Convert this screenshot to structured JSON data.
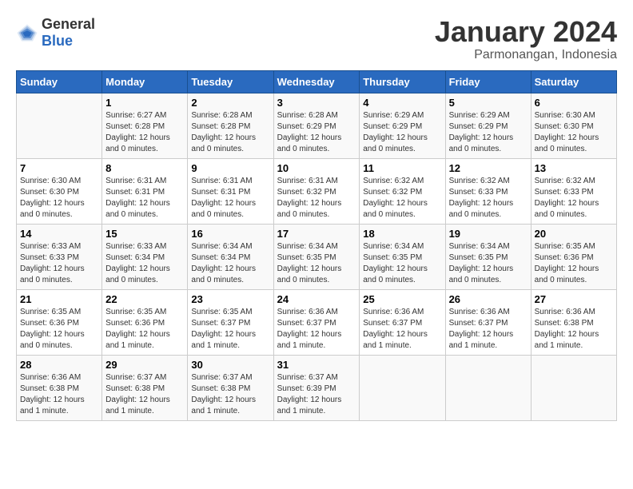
{
  "header": {
    "logo": {
      "general": "General",
      "blue": "Blue"
    },
    "title": "January 2024",
    "subtitle": "Parmonangan, Indonesia"
  },
  "days_of_week": [
    "Sunday",
    "Monday",
    "Tuesday",
    "Wednesday",
    "Thursday",
    "Friday",
    "Saturday"
  ],
  "weeks": [
    [
      {
        "day": null
      },
      {
        "day": "1",
        "sunrise": "6:27 AM",
        "sunset": "6:28 PM",
        "daylight": "12 hours and 0 minutes."
      },
      {
        "day": "2",
        "sunrise": "6:28 AM",
        "sunset": "6:28 PM",
        "daylight": "12 hours and 0 minutes."
      },
      {
        "day": "3",
        "sunrise": "6:28 AM",
        "sunset": "6:29 PM",
        "daylight": "12 hours and 0 minutes."
      },
      {
        "day": "4",
        "sunrise": "6:29 AM",
        "sunset": "6:29 PM",
        "daylight": "12 hours and 0 minutes."
      },
      {
        "day": "5",
        "sunrise": "6:29 AM",
        "sunset": "6:29 PM",
        "daylight": "12 hours and 0 minutes."
      },
      {
        "day": "6",
        "sunrise": "6:30 AM",
        "sunset": "6:30 PM",
        "daylight": "12 hours and 0 minutes."
      }
    ],
    [
      {
        "day": "7",
        "sunrise": "6:30 AM",
        "sunset": "6:30 PM",
        "daylight": "12 hours and 0 minutes."
      },
      {
        "day": "8",
        "sunrise": "6:31 AM",
        "sunset": "6:31 PM",
        "daylight": "12 hours and 0 minutes."
      },
      {
        "day": "9",
        "sunrise": "6:31 AM",
        "sunset": "6:31 PM",
        "daylight": "12 hours and 0 minutes."
      },
      {
        "day": "10",
        "sunrise": "6:31 AM",
        "sunset": "6:32 PM",
        "daylight": "12 hours and 0 minutes."
      },
      {
        "day": "11",
        "sunrise": "6:32 AM",
        "sunset": "6:32 PM",
        "daylight": "12 hours and 0 minutes."
      },
      {
        "day": "12",
        "sunrise": "6:32 AM",
        "sunset": "6:33 PM",
        "daylight": "12 hours and 0 minutes."
      },
      {
        "day": "13",
        "sunrise": "6:32 AM",
        "sunset": "6:33 PM",
        "daylight": "12 hours and 0 minutes."
      }
    ],
    [
      {
        "day": "14",
        "sunrise": "6:33 AM",
        "sunset": "6:33 PM",
        "daylight": "12 hours and 0 minutes."
      },
      {
        "day": "15",
        "sunrise": "6:33 AM",
        "sunset": "6:34 PM",
        "daylight": "12 hours and 0 minutes."
      },
      {
        "day": "16",
        "sunrise": "6:34 AM",
        "sunset": "6:34 PM",
        "daylight": "12 hours and 0 minutes."
      },
      {
        "day": "17",
        "sunrise": "6:34 AM",
        "sunset": "6:35 PM",
        "daylight": "12 hours and 0 minutes."
      },
      {
        "day": "18",
        "sunrise": "6:34 AM",
        "sunset": "6:35 PM",
        "daylight": "12 hours and 0 minutes."
      },
      {
        "day": "19",
        "sunrise": "6:34 AM",
        "sunset": "6:35 PM",
        "daylight": "12 hours and 0 minutes."
      },
      {
        "day": "20",
        "sunrise": "6:35 AM",
        "sunset": "6:36 PM",
        "daylight": "12 hours and 0 minutes."
      }
    ],
    [
      {
        "day": "21",
        "sunrise": "6:35 AM",
        "sunset": "6:36 PM",
        "daylight": "12 hours and 0 minutes."
      },
      {
        "day": "22",
        "sunrise": "6:35 AM",
        "sunset": "6:36 PM",
        "daylight": "12 hours and 1 minute."
      },
      {
        "day": "23",
        "sunrise": "6:35 AM",
        "sunset": "6:37 PM",
        "daylight": "12 hours and 1 minute."
      },
      {
        "day": "24",
        "sunrise": "6:36 AM",
        "sunset": "6:37 PM",
        "daylight": "12 hours and 1 minute."
      },
      {
        "day": "25",
        "sunrise": "6:36 AM",
        "sunset": "6:37 PM",
        "daylight": "12 hours and 1 minute."
      },
      {
        "day": "26",
        "sunrise": "6:36 AM",
        "sunset": "6:37 PM",
        "daylight": "12 hours and 1 minute."
      },
      {
        "day": "27",
        "sunrise": "6:36 AM",
        "sunset": "6:38 PM",
        "daylight": "12 hours and 1 minute."
      }
    ],
    [
      {
        "day": "28",
        "sunrise": "6:36 AM",
        "sunset": "6:38 PM",
        "daylight": "12 hours and 1 minute."
      },
      {
        "day": "29",
        "sunrise": "6:37 AM",
        "sunset": "6:38 PM",
        "daylight": "12 hours and 1 minute."
      },
      {
        "day": "30",
        "sunrise": "6:37 AM",
        "sunset": "6:38 PM",
        "daylight": "12 hours and 1 minute."
      },
      {
        "day": "31",
        "sunrise": "6:37 AM",
        "sunset": "6:39 PM",
        "daylight": "12 hours and 1 minute."
      },
      {
        "day": null
      },
      {
        "day": null
      },
      {
        "day": null
      }
    ]
  ],
  "labels": {
    "sunrise": "Sunrise:",
    "sunset": "Sunset:",
    "daylight": "Daylight:"
  }
}
